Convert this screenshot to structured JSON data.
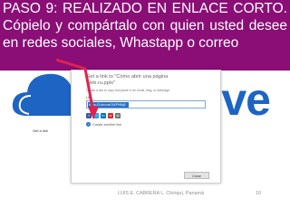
{
  "banner": {
    "text": "PASO 9: REALIZADO EN ENLACE CORTO. Cópielo y compártalo con quien usted desee en redes sociales, Whastapp o correo",
    "background": "#8a0e76"
  },
  "brand": {
    "text": "rive",
    "color": "#1d64c3"
  },
  "sidebar_link": {
    "label": "Get a link"
  },
  "dialog": {
    "title": "Get a link to \"Cómo abrir una página Web.ru.pptx\"",
    "subtitle": "Create a link to copy and paste in an email, blog, or webpage",
    "link_label": "Link",
    "url_value": "https://1drv.ms/1WFH8q5",
    "share_icons": [
      "facebook-icon",
      "twitter-icon",
      "linkedin-icon",
      "sina-icon",
      "email-icon"
    ],
    "create_label": "Create another link",
    "close_label": "Close"
  },
  "footer": {
    "author": "LUIS E. CABRERA L.  Chiriquí, Panamá",
    "page_number": "10"
  },
  "colors": {
    "accent": "#2a6fc9",
    "arrow": "#e0224f"
  }
}
